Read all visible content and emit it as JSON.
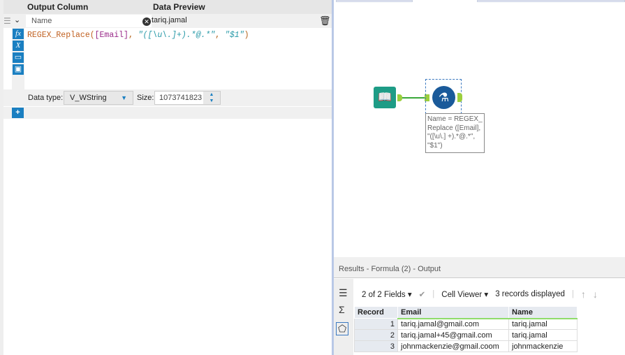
{
  "formula_panel": {
    "headers": {
      "output_column": "Output Column",
      "data_preview": "Data Preview"
    },
    "field_name": "Name",
    "preview_value": "tariq.jamal",
    "expression": {
      "func": "REGEX_Replace(",
      "field": "[Email]",
      "sep": ", ",
      "pattern": "\"([\\u\\.]+).*@.*\"",
      "sep2": ", ",
      "replacement": "\"$1\"",
      "close": ")"
    },
    "data_type_label": "Data type:",
    "data_type_value": "V_WString",
    "size_label": "Size:",
    "size_value": "1073741823",
    "icons": [
      "fx-icon",
      "variable-icon",
      "open-folder-icon",
      "save-icon"
    ]
  },
  "canvas": {
    "annotation": "Name = REGEX_Replace ([Email], \"([\\u\\.] +).*@.*\", \"$1\")"
  },
  "results": {
    "title": "Results - Formula (2) - Output",
    "fields_selector": "2 of 2 Fields",
    "cell_viewer": "Cell Viewer",
    "records_displayed": "3 records displayed",
    "columns": [
      "Record",
      "Email",
      "Name"
    ],
    "rows": [
      [
        "1",
        "tariq.jamal@gmail.com",
        "tariq.jamal"
      ],
      [
        "2",
        "tariq.jamal+45@gmail.com",
        "tariq.jamal"
      ],
      [
        "3",
        "johnmackenzie@gmail.coom",
        "johnmackenzie"
      ]
    ]
  },
  "colors": {
    "accent": "#1a7fc1",
    "input_tool": "#1e9c86",
    "formula_tool": "#1a5a9a",
    "connection": "#3aa83a"
  }
}
